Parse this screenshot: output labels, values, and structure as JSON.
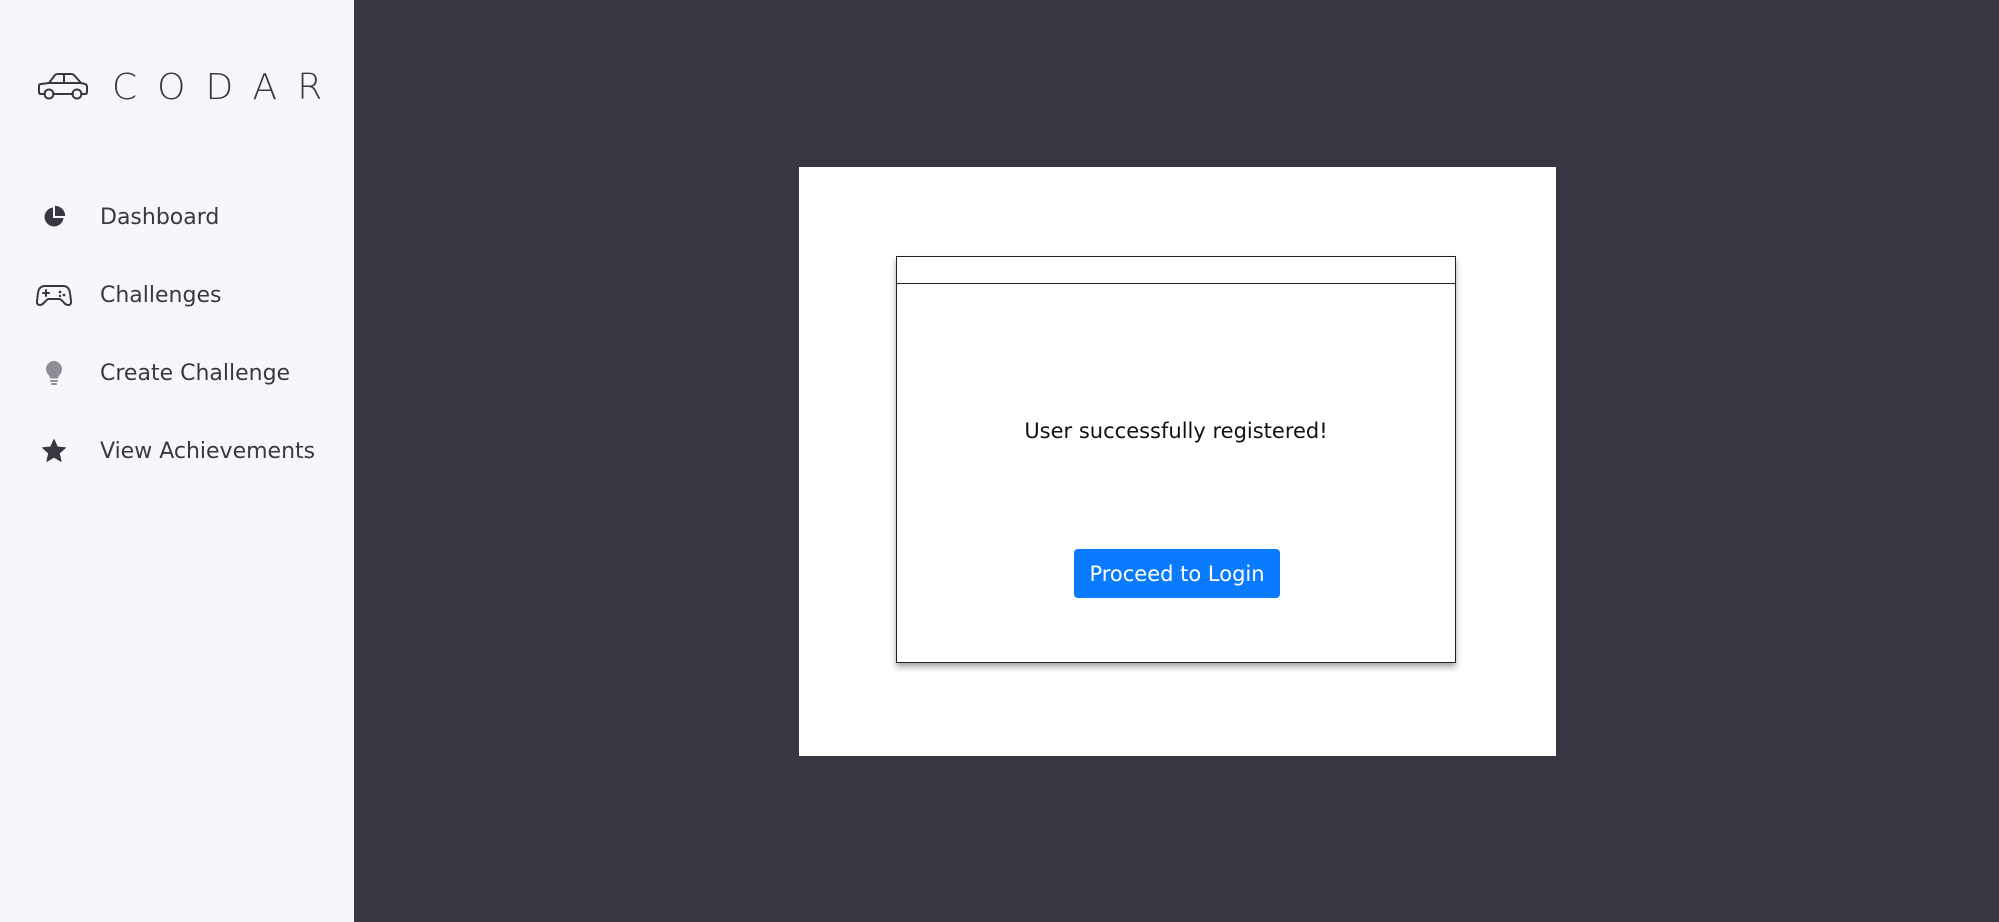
{
  "brand": {
    "name": "CODAR",
    "icon": "car-icon"
  },
  "sidebar": {
    "items": [
      {
        "label": "Dashboard",
        "icon": "pie-chart-icon"
      },
      {
        "label": "Challenges",
        "icon": "gamepad-icon"
      },
      {
        "label": "Create Challenge",
        "icon": "lightbulb-icon"
      },
      {
        "label": "View Achievements",
        "icon": "star-icon"
      }
    ]
  },
  "dialog": {
    "message": "User successfully registered!",
    "button_label": "Proceed to Login"
  },
  "colors": {
    "background": "#383842",
    "sidebar": "#f6f7fb",
    "primary_button": "#0a7bff",
    "text": "#383842"
  }
}
